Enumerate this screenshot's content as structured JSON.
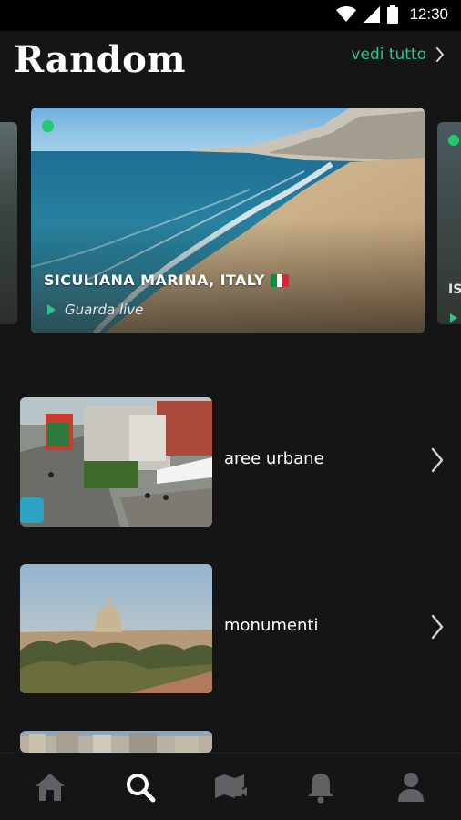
{
  "status_bar": {
    "time": "12:30",
    "icons": [
      "wifi-icon",
      "cellular-signal-icon",
      "battery-icon"
    ]
  },
  "header": {
    "title": "Random",
    "see_all_label": "vedi tutto",
    "see_all_icon": "chevron-right-icon"
  },
  "featured": {
    "location": "SICULIANA MARINA, ITALY",
    "flag": "italy-flag-icon",
    "watch_label": "Guarda live",
    "live": true,
    "adjacent_right_peek": "IS"
  },
  "categories": [
    {
      "label": "aree urbane",
      "icon": "chevron-right-icon"
    },
    {
      "label": "monumenti",
      "icon": "chevron-right-icon"
    }
  ],
  "bottom_nav": [
    {
      "name": "home",
      "icon": "home-icon",
      "active": false
    },
    {
      "name": "search",
      "icon": "search-icon",
      "active": true
    },
    {
      "name": "map",
      "icon": "map-camera-icon",
      "active": false
    },
    {
      "name": "notifications",
      "icon": "bell-icon",
      "active": false
    },
    {
      "name": "profile",
      "icon": "person-icon",
      "active": false
    }
  ],
  "colors": {
    "accent": "#2fc28a",
    "live_indicator": "#23c96b",
    "background": "#151516",
    "nav_active": "#ffffff",
    "nav_inactive": "#5f6164"
  }
}
